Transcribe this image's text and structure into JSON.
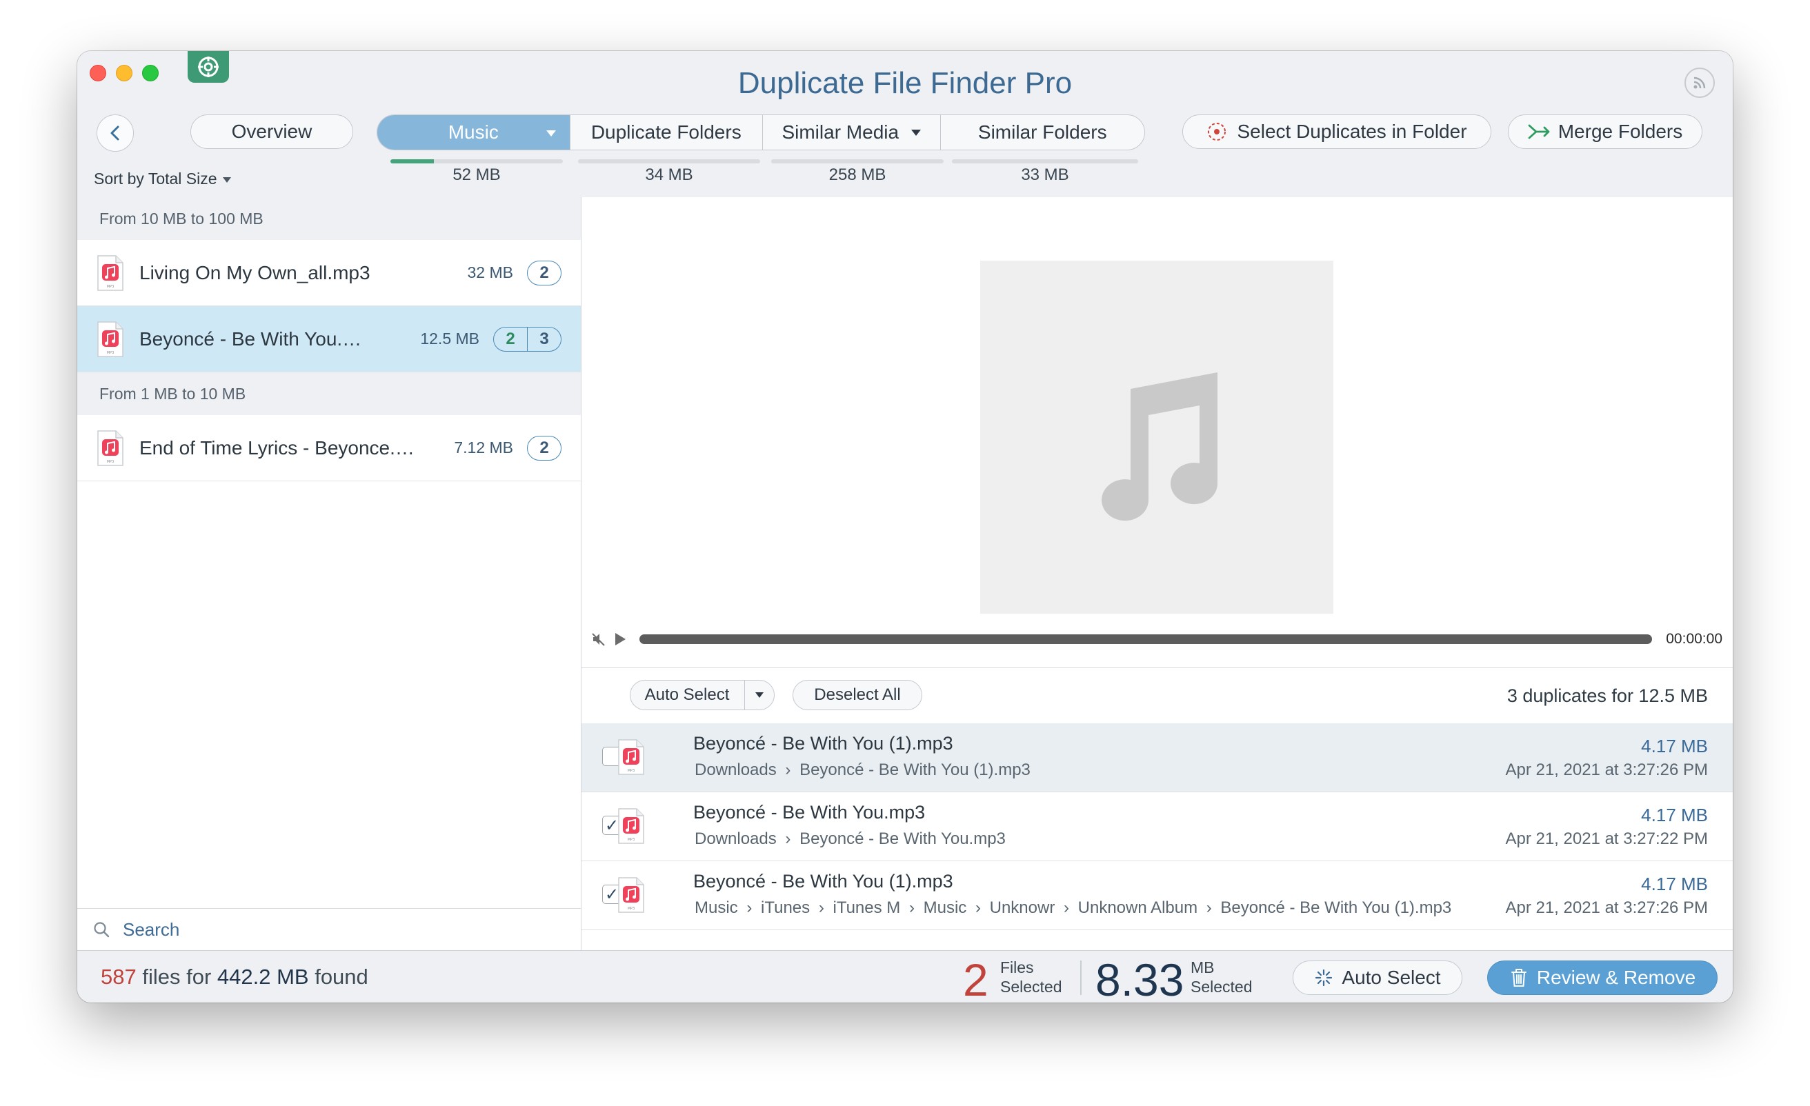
{
  "app": {
    "title": "Duplicate File Finder Pro"
  },
  "toolbar": {
    "overview_label": "Overview",
    "tabs": [
      {
        "label": "Music",
        "size": "52 MB",
        "progress": 0.25,
        "active": true,
        "has_dropdown": true
      },
      {
        "label": "Duplicate Folders",
        "size": "34 MB",
        "progress": 0,
        "active": false,
        "has_dropdown": false
      },
      {
        "label": "Similar Media",
        "size": "258 MB",
        "progress": 0,
        "active": false,
        "has_dropdown": true
      },
      {
        "label": "Similar Folders",
        "size": "33 MB",
        "progress": 0,
        "active": false,
        "has_dropdown": false
      }
    ],
    "select_duplicates_label": "Select Duplicates in Folder",
    "merge_folders_label": "Merge Folders",
    "sort_label": "Sort by Total Size"
  },
  "sidebar": {
    "groups": [
      {
        "header": "From 10 MB to 100 MB",
        "items": [
          {
            "name": "Living On My Own_all.mp3",
            "size": "32 MB",
            "counts": [
              "2"
            ],
            "selected": false
          },
          {
            "name": "Beyoncé - Be With You.…",
            "size": "12.5 MB",
            "counts": [
              "2",
              "3"
            ],
            "selected": true
          }
        ]
      },
      {
        "header": "From 1 MB to 10 MB",
        "items": [
          {
            "name": "End of Time Lyrics - Beyonce.…",
            "size": "7.12 MB",
            "counts": [
              "2"
            ],
            "selected": false
          }
        ]
      }
    ],
    "search_label": "Search"
  },
  "player": {
    "time": "00:00:00"
  },
  "duplicates": {
    "auto_select_label": "Auto Select",
    "deselect_all_label": "Deselect All",
    "summary": "3 duplicates for 12.5 MB",
    "rows": [
      {
        "name": "Beyoncé - Be With You (1).mp3",
        "path": [
          "Downloads",
          "Beyoncé - Be With You (1).mp3"
        ],
        "size": "4.17 MB",
        "date": "Apr 21, 2021 at 3:27:26 PM",
        "checked": false
      },
      {
        "name": "Beyoncé - Be With You.mp3",
        "path": [
          "Downloads",
          "Beyoncé - Be With You.mp3"
        ],
        "size": "4.17 MB",
        "date": "Apr 21, 2021 at 3:27:22 PM",
        "checked": true
      },
      {
        "name": "Beyoncé - Be With You (1).mp3",
        "path": [
          "Music",
          "iTunes",
          "iTunes M",
          "Music",
          "Unknowr",
          "Unknown Album",
          "Beyoncé - Be With You (1).mp3"
        ],
        "size": "4.17 MB",
        "date": "Apr 21, 2021 at 3:27:26 PM",
        "checked": true
      }
    ]
  },
  "status": {
    "files_count": "587",
    "files_mid": " files for ",
    "files_size": "442.2 MB",
    "files_end": " found",
    "selected_files": "2",
    "files_selected_l1": "Files",
    "files_selected_l2": "Selected",
    "selected_mb": "8.33",
    "mb_selected_l1": "MB",
    "mb_selected_l2": "Selected",
    "auto_select_label": "Auto Select",
    "review_remove_label": "Review & Remove"
  },
  "colors": {
    "accent": "#5aa0d4",
    "active_tab": "#86b7da",
    "progress": "#43a37b",
    "selected_row": "#cfe8f6",
    "count_red": "#c0443c"
  },
  "icons": [
    "back-chevron-icon",
    "rss-icon",
    "target-icon",
    "merge-arrow-icon",
    "music-file-icon",
    "music-note-icon",
    "mute-icon",
    "play-icon",
    "search-icon",
    "sparkle-icon",
    "trash-icon"
  ]
}
